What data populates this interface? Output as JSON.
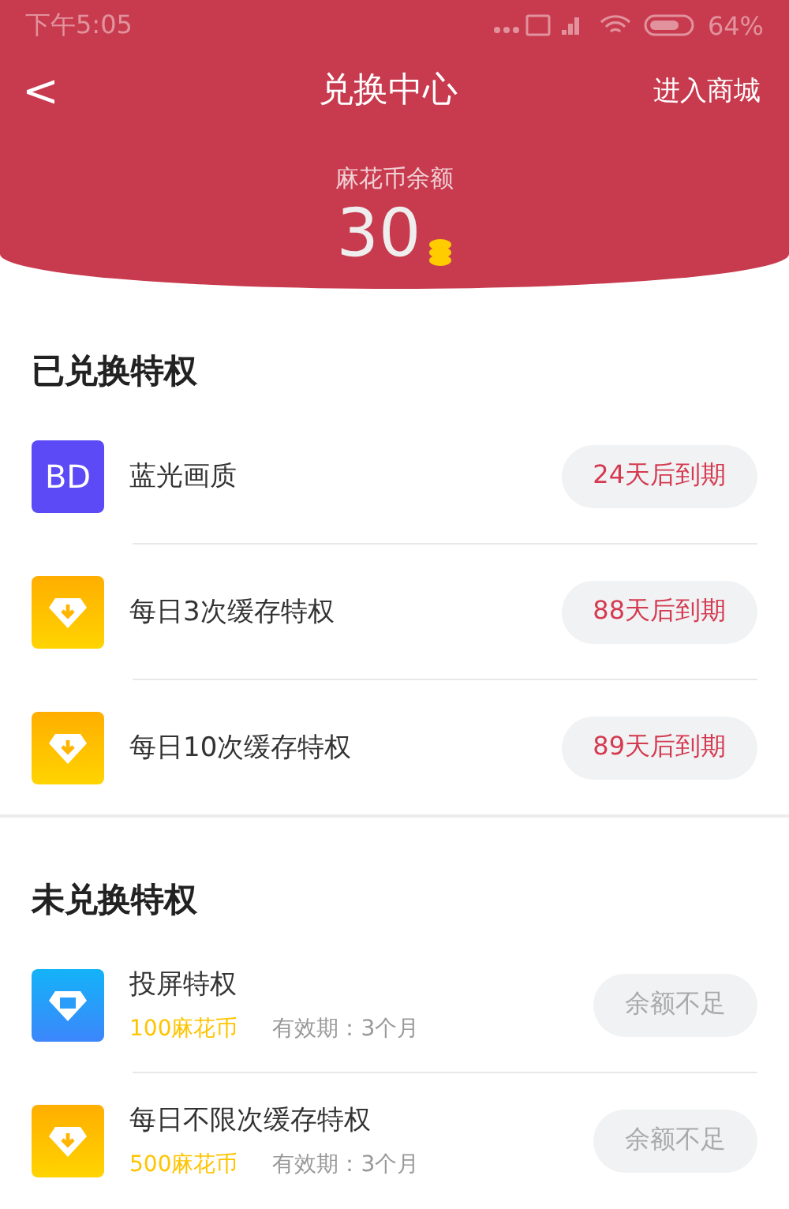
{
  "status_bar": {
    "time": "下午5:05",
    "battery": "64%"
  },
  "nav": {
    "back": "<",
    "title": "兑换中心",
    "action": "进入商城"
  },
  "balance": {
    "label": "麻花币余额",
    "amount": "30"
  },
  "redeemed": {
    "title": "已兑换特权",
    "items": [
      {
        "kind": "bd",
        "icon_text": "BD",
        "name": "蓝光画质",
        "status": "24天后到期",
        "disabled": false
      },
      {
        "kind": "download",
        "name": "每日3次缓存特权",
        "status": "88天后到期",
        "disabled": false
      },
      {
        "kind": "download",
        "name": "每日10次缓存特权",
        "status": "89天后到期",
        "disabled": false
      }
    ]
  },
  "available": {
    "title": "未兑换特权",
    "items": [
      {
        "kind": "cast",
        "name": "投屏特权",
        "price": "100麻花币",
        "validity": "有效期：3个月",
        "status": "余额不足",
        "disabled": true
      },
      {
        "kind": "download",
        "name": "每日不限次缓存特权",
        "price": "500麻花币",
        "validity": "有效期：3个月",
        "status": "余额不足",
        "disabled": true
      }
    ]
  }
}
